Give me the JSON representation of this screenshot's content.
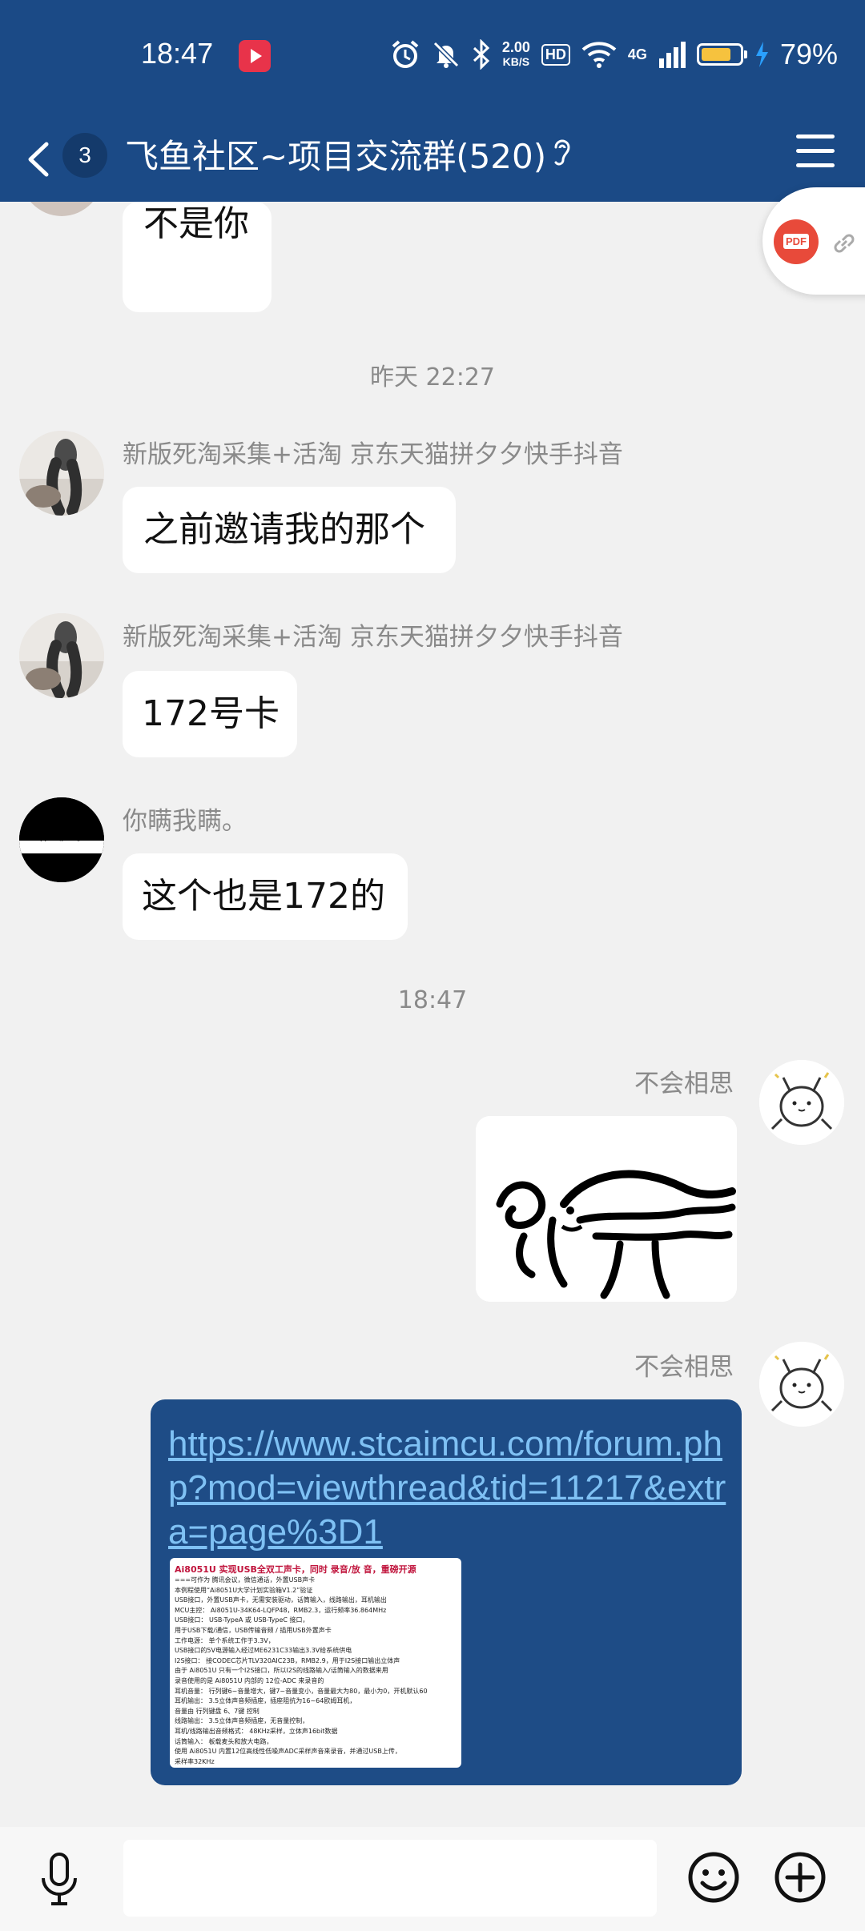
{
  "status_bar": {
    "time": "18:47",
    "net_speed_value": "2.00",
    "net_speed_unit": "KB/S",
    "hd": "HD",
    "network": "4G",
    "battery_percent": "79%",
    "battery_level": 0.79
  },
  "header": {
    "unread_count": "3",
    "title": "飞鱼社区~项目交流群(520)"
  },
  "floating_tools": {
    "pdf_label": "PDF"
  },
  "messages": {
    "m0": {
      "text": "不是你"
    },
    "t1": "昨天 22:27",
    "m1": {
      "sender": "新版死淘采集+活淘 京东天猫拼夕夕快手抖音",
      "text": "之前邀请我的那个"
    },
    "m2": {
      "sender": "新版死淘采集+活淘 京东天猫拼夕夕快手抖音",
      "text": "172号卡"
    },
    "m3": {
      "sender": "你瞒我瞒。",
      "text": "这个也是172的"
    },
    "t2": "18:47",
    "m4": {
      "sender": "不会相思"
    },
    "m5": {
      "sender": "不会相思",
      "url": "https://www.stcaimcu.com/forum.php?mod=viewthread&tid=11217&extra=page%3D1",
      "preview": {
        "heading": "Ai8051U 实现USB全双工声卡，同时 录音/放 音，重磅开源",
        "lines": [
          "===可作为 腾讯会议，微信通话，外置USB声卡",
          "本例程使用“Ai8051U大学计划实验箱V1.2”验证",
          "USB接口，外置USB声卡，无需安装驱动，话筒输入，线路输出，耳机输出",
          "MCU主控：  Ai8051U-34K64-LQFP48，RMB2.3，运行频率36.864MHz",
          "USB接口：  USB-TypeA 或 USB-TypeC 接口，",
          "           用于USB下载/通信，USB传输音频 / 插用USB外置声卡",
          "工作电源：  单个系统工作于3.3V，",
          "           USB接口的5V电源输入经过ME6231C33输出3.3V给系统供电",
          "I2S接口：  接CODEC芯片TLV320AIC23B，RMB2.9，用于I2S接口输出立体声",
          "           由于 Ai8051U 只有一个I2S接口，所以I2S的线路输入/话筒输入的数据来用",
          "           录音使用的是 Ai8051U 内部的 12位-ADC 来录音的",
          "耳机音量：  行列键6~音量增大，键7~音量变小，音量最大为80，最小为0，开机默认60",
          "耳机输出：  3.5立体声音频插座，插座阻抗为16~64欧姆耳机，",
          "           音量由 行列键盘 6、7键 控制",
          "线路输出：  3.5立体声音频插座，无音量控制，",
          "           耳机/线路输出音频格式：  48KHz采样，立体声16bit数据",
          "话筒输入：  板载麦头和放大电路，",
          "           使用 Ai8051U 内置12位高线性低噪声ADC采样声音来录音，并通过USB上传，",
          "           采样率32KHz"
        ]
      }
    }
  },
  "input_bar": {
    "text": ""
  }
}
